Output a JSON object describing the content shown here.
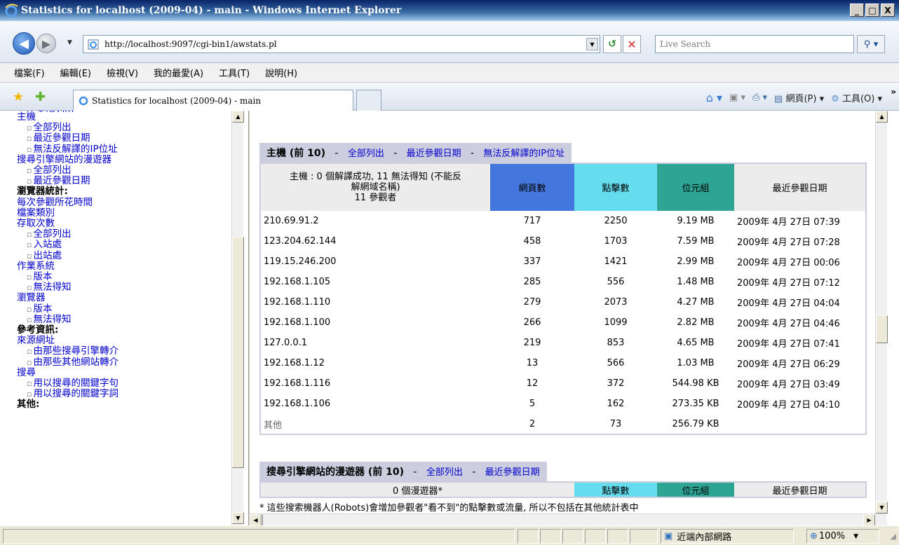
{
  "window": {
    "title": "Statistics for localhost (2009-04) - main - Windows Internet Explorer",
    "buttons": {
      "minimize": "_",
      "maximize": "□",
      "close": "X"
    }
  },
  "address": {
    "url": "http://localhost:9097/cgi-bin1/awstats.pl",
    "search_placeholder": "Live Search"
  },
  "menu": [
    "檔案(F)",
    "編輯(E)",
    "檢視(V)",
    "我的最愛(A)",
    "工具(T)",
    "說明(H)"
  ],
  "tab": {
    "label": "Statistics for localhost (2009-04) - main"
  },
  "commands": {
    "page": "網頁(P)",
    "tools": "工具(O)"
  },
  "sidebar": {
    "items": [
      {
        "text": "主機",
        "kind": "head"
      },
      {
        "text": "全部列出",
        "kind": "sub"
      },
      {
        "text": "最近參觀日期",
        "kind": "sub"
      },
      {
        "text": "無法反解譯的IP位址",
        "kind": "sub"
      },
      {
        "text": "搜尋引擎網站的漫遊器",
        "kind": "head"
      },
      {
        "text": "全部列出",
        "kind": "sub"
      },
      {
        "text": "最近參觀日期",
        "kind": "sub"
      },
      {
        "text": "瀏覽器統計:",
        "kind": "bold"
      },
      {
        "text": "每次參觀所花時間",
        "kind": "head"
      },
      {
        "text": "檔案類別",
        "kind": "head"
      },
      {
        "text": "存取次數",
        "kind": "head"
      },
      {
        "text": "全部列出",
        "kind": "sub"
      },
      {
        "text": "入站處",
        "kind": "sub"
      },
      {
        "text": "出站處",
        "kind": "sub"
      },
      {
        "text": "作業系統",
        "kind": "head"
      },
      {
        "text": "版本",
        "kind": "sub"
      },
      {
        "text": "無法得知",
        "kind": "sub"
      },
      {
        "text": "瀏覽器",
        "kind": "head"
      },
      {
        "text": "版本",
        "kind": "sub"
      },
      {
        "text": "無法得知",
        "kind": "sub"
      },
      {
        "text": "參考資訊:",
        "kind": "bold"
      },
      {
        "text": "來源網址",
        "kind": "head"
      },
      {
        "text": "由那些搜尋引擎轉介",
        "kind": "sub"
      },
      {
        "text": "由那些其他網站轉介",
        "kind": "sub"
      },
      {
        "text": "搜尋",
        "kind": "head"
      },
      {
        "text": "用以搜尋的關鍵字句",
        "kind": "sub"
      },
      {
        "text": "用以搜尋的關鍵字詞",
        "kind": "sub"
      },
      {
        "text": "其他:",
        "kind": "bold"
      }
    ]
  },
  "hosts_section": {
    "title": "主機 (前 10)",
    "sep": "-",
    "links": [
      "全部列出",
      "最近參觀日期",
      "無法反解譯的IP位址"
    ],
    "header_desc": [
      "主機 : 0 個解譯成功, 11 無法得知 (不能反",
      "解網域名稱)",
      "11 參觀者"
    ],
    "columns": [
      "網頁數",
      "點擊數",
      "位元組",
      "最近參觀日期"
    ],
    "rows": [
      {
        "host": "210.69.91.2",
        "pages": "717",
        "hits": "2250",
        "bytes": "9.19 MB",
        "last": "2009年 4月 27日 07:39"
      },
      {
        "host": "123.204.62.144",
        "pages": "458",
        "hits": "1703",
        "bytes": "7.59 MB",
        "last": "2009年 4月 27日 07:28"
      },
      {
        "host": "119.15.246.200",
        "pages": "337",
        "hits": "1421",
        "bytes": "2.99 MB",
        "last": "2009年 4月 27日 00:06"
      },
      {
        "host": "192.168.1.105",
        "pages": "285",
        "hits": "556",
        "bytes": "1.48 MB",
        "last": "2009年 4月 27日 07:12"
      },
      {
        "host": "192.168.1.110",
        "pages": "279",
        "hits": "2073",
        "bytes": "4.27 MB",
        "last": "2009年 4月 27日 04:04"
      },
      {
        "host": "192.168.1.100",
        "pages": "266",
        "hits": "1099",
        "bytes": "2.82 MB",
        "last": "2009年 4月 27日 04:46"
      },
      {
        "host": "127.0.0.1",
        "pages": "219",
        "hits": "853",
        "bytes": "4.65 MB",
        "last": "2009年 4月 27日 07:41"
      },
      {
        "host": "192.168.1.12",
        "pages": "13",
        "hits": "566",
        "bytes": "1.03 MB",
        "last": "2009年 4月 27日 06:29"
      },
      {
        "host": "192.168.1.116",
        "pages": "12",
        "hits": "372",
        "bytes": "544.98 KB",
        "last": "2009年 4月 27日 03:49"
      },
      {
        "host": "192.168.1.106",
        "pages": "5",
        "hits": "162",
        "bytes": "273.35 KB",
        "last": "2009年 4月 27日 04:10"
      },
      {
        "host": "其他",
        "pages": "2",
        "hits": "73",
        "bytes": "256.79 KB",
        "last": ""
      }
    ]
  },
  "robots_section": {
    "title": "搜尋引擎網站的漫遊器 (前 10)",
    "sep": "-",
    "links": [
      "全部列出",
      "最近參觀日期"
    ],
    "header_desc": "0 個漫遊器*",
    "columns": [
      "點擊數",
      "位元組",
      "最近參觀日期"
    ],
    "note": "* 這些搜索機器人(Robots)會增加參觀者\"看不到\"的點擊數或流量, 所以不包括在其他統計表中"
  },
  "status": {
    "zone": "近端內部網路",
    "zoom": "100%"
  },
  "colors": {
    "pages": "#4477dd",
    "hits": "#66ddee",
    "bytes": "#2ea495",
    "section": "#cccdde"
  }
}
